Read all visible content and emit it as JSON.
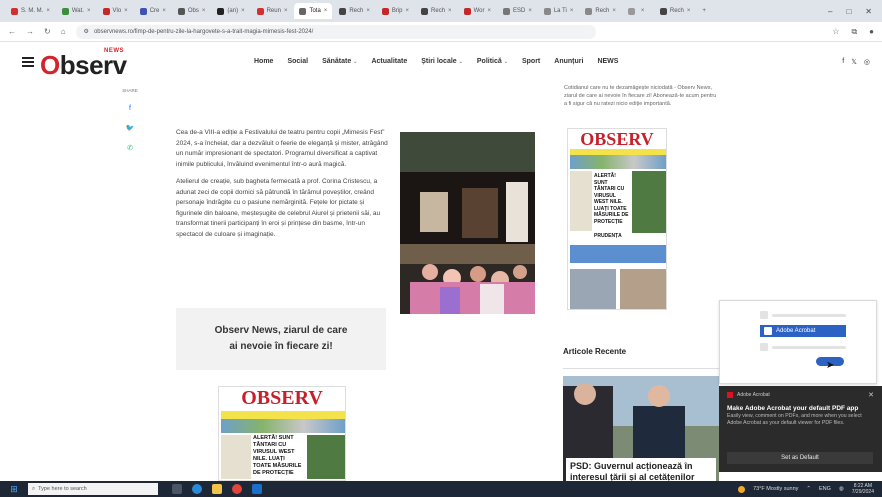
{
  "browser": {
    "tabs": [
      {
        "label": "S. M. M.",
        "color": "#d03030"
      },
      {
        "label": "Wat.",
        "color": "#3b8e3b"
      },
      {
        "label": "Vlo",
        "color": "#c62828"
      },
      {
        "label": "Cre",
        "color": "#3f51b5"
      },
      {
        "label": "Obs",
        "color": "#555555"
      },
      {
        "label": "(an)",
        "color": "#222222"
      },
      {
        "label": "Reun",
        "color": "#d03030"
      },
      {
        "label": "Tota",
        "color": "#666666",
        "active": true
      },
      {
        "label": "Rech",
        "color": "#444444"
      },
      {
        "label": "Brip",
        "color": "#c62828"
      },
      {
        "label": "Rech",
        "color": "#444444"
      },
      {
        "label": "Wor",
        "color": "#c62828"
      },
      {
        "label": "ESD",
        "color": "#777777"
      },
      {
        "label": "La Ti",
        "color": "#888888"
      },
      {
        "label": "Rech",
        "color": "#888888"
      },
      {
        "label": "",
        "color": "#999999"
      },
      {
        "label": "Rech",
        "color": "#444444"
      }
    ],
    "url": "observnews.ro/fimp-de-pentru-zile-la-hargovete-s-a-trait-magia-mimesis-fest-2024/",
    "window_controls": [
      "–",
      "□",
      "✕"
    ]
  },
  "site": {
    "logo_text": "Observ",
    "logo_first_letter": "O",
    "logo_rest": "bserv",
    "logo_news": "NEWS",
    "menu": [
      {
        "label": "Home",
        "has_dropdown": false
      },
      {
        "label": "Social",
        "has_dropdown": false
      },
      {
        "label": "Sănătate",
        "has_dropdown": true
      },
      {
        "label": "Actualitate",
        "has_dropdown": false
      },
      {
        "label": "Știri locale",
        "has_dropdown": true
      },
      {
        "label": "Politică",
        "has_dropdown": true
      },
      {
        "label": "Sport",
        "has_dropdown": false
      },
      {
        "label": "Anunțuri",
        "has_dropdown": false
      },
      {
        "label": "NEWS",
        "has_dropdown": false
      }
    ],
    "social_icons": [
      "f",
      "𝕏",
      "◎"
    ]
  },
  "share": {
    "label": "SHARE",
    "icons": [
      {
        "name": "facebook-icon",
        "glyph": "f",
        "color": "#1877f2"
      },
      {
        "name": "twitter-icon",
        "glyph": "🐦",
        "color": "#1da1f2"
      },
      {
        "name": "whatsapp-icon",
        "glyph": "✆",
        "color": "#25d366"
      }
    ]
  },
  "article": {
    "paragraphs": [
      "Cea de-a VIII-a ediție a Festivalului de teatru pentru copii „Mimesis Fest” 2024, s-a încheiat, dar a dezvăluit o feerie de eleganță și mister, atrăgând un număr impresionant de spectatori. Programul diversificat a captivat inimile publicului, învăluind evenimentul într-o aură magică.",
      "Atelierul de creație, sub bagheta fermecată a prof. Corina Cristescu, a adunat zeci de copii dornici să pătrundă în tărâmul poveștilor, creând personaje îndrăgite cu o pasiune nemărginită. Fețele lor pictate și figurinele din baloane, meșteșugite de celebrul Aiurel și prietenii săi, au transformat tinerii participanți în eroi și prințese din basme, într-un spectacol de culoare și imaginație."
    ],
    "promo_line1": "Observ News, ziarul de care",
    "promo_line2": "ai nevoie în fiecare zi!"
  },
  "sidebar": {
    "subscribe_text": "Cotidianul care nu te dezamăgește niciodată - Observ News, ziarul de care ai nevoie în fiecare zi! Abonează-te acum pentru a fi sigur că nu ratezi nicio ediție importantă.",
    "paper_masthead": "OBSERV",
    "paper_headline": "ALERTĂ! SUNT TĂNTARI CU VIRUSUL WEST NILE. LUAȚI TOATE MĂSURILE DE PROTECȚIE",
    "paper_sub": "PRUDENȚA",
    "recent_title": "Articole Recente",
    "recent_caption": "PSD: Guvernul acționează în interesul țării și al cetățenilor"
  },
  "pdf_popup": {
    "selected_app": "Adobe Acrobat"
  },
  "toast": {
    "app": "Adobe Acrobat",
    "title": "Make Adobe Acrobat your default PDF app",
    "description": "Easily view, comment on PDFs, and more when you select Adobe Acrobat as your default viewer for PDF files.",
    "button": "Set as Default",
    "close": "✕"
  },
  "taskbar": {
    "search_placeholder": "Type here to search",
    "weather": "73°F  Mostly sunny",
    "lang": "ENG",
    "time": "8:22 AM",
    "date": "7/29/2024"
  }
}
